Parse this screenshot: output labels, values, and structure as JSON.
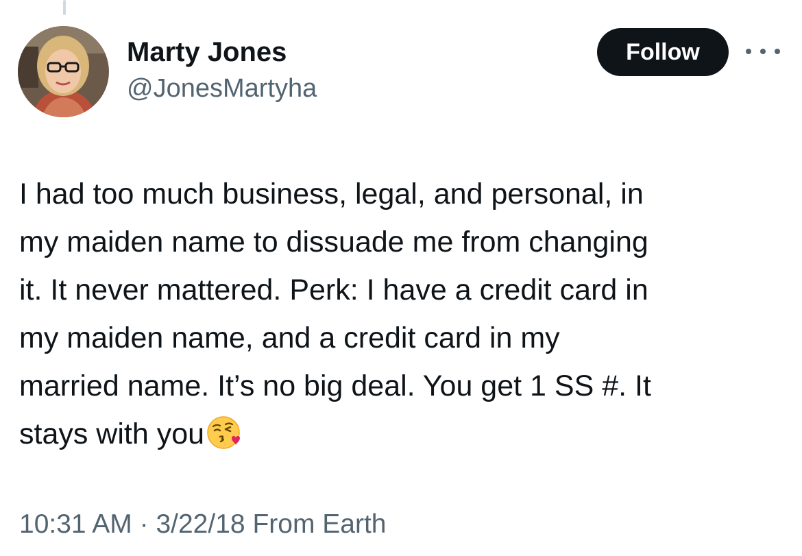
{
  "tweet": {
    "author": {
      "display_name": "Marty Jones",
      "handle": "@JonesMartyha",
      "avatar": "profile-photo"
    },
    "follow_label": "Follow",
    "more_icon": "more-horizontal-icon",
    "text_lines": [
      "I had too much business, legal, and personal, in",
      "my maiden name to dissuade me from changing",
      "it. It never mattered. Perk: I have a credit card in",
      "my maiden name, and a credit card in my",
      "married name. It’s no big deal. You get 1 SS #. It",
      "stays with you"
    ],
    "emoji": "face-blowing-a-kiss-emoji",
    "time": "10:31 AM",
    "separator": "·",
    "date": "3/22/18",
    "source": "From Earth"
  },
  "colors": {
    "text_primary": "#0f1419",
    "text_secondary": "#536471",
    "button_bg": "#0f1419",
    "button_text": "#ffffff",
    "thread_line": "#cfd9de"
  }
}
